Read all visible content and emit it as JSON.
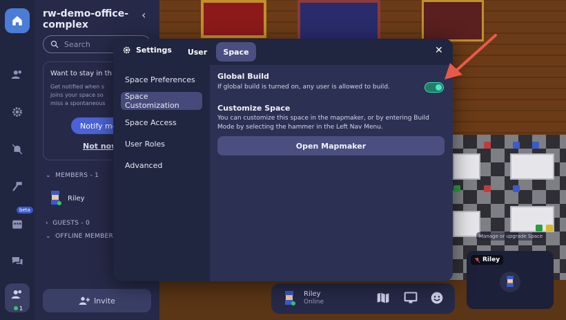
{
  "sidebar": {
    "space_name": "rw-demo-office-complex",
    "search_placeholder": "Search",
    "notify": {
      "title": "Want to stay in th",
      "desc1": "Get notified when s",
      "desc2": "joins your space so",
      "desc3": "miss a spontaneous",
      "button": "Notify me",
      "not_now": "Not now"
    },
    "members_header": "MEMBERS - 1",
    "member_name": "Riley",
    "guests_header": "GUESTS - 0",
    "offline_header": "OFFLINE MEMBER",
    "invite_label": "Invite",
    "rail": {
      "beta": "beta",
      "members_count": "1"
    }
  },
  "settings": {
    "title": "Settings",
    "tabs": [
      "User",
      "Space"
    ],
    "active_tab": "Space",
    "nav": [
      "Space Preferences",
      "Space Customization",
      "Space Access",
      "User Roles",
      "Advanced"
    ],
    "active_nav": "Space Customization",
    "global_build": {
      "title": "Global Build",
      "desc": "If global build is turned on, any user is allowed to build.",
      "enabled": true
    },
    "customize": {
      "title": "Customize Space",
      "desc_line1": "You can customize this space in the mapmaker, or by entering Build",
      "desc_line2": "Mode by selecting the hammer in the Left Nav Menu.",
      "button": "Open Mapmaker"
    }
  },
  "bottombar": {
    "name": "Riley",
    "status": "Online"
  },
  "video": {
    "name": "Riley"
  },
  "game": {
    "manage_hint": "Manage or upgrade Space"
  },
  "colors": {
    "accent": "#4b7dd6",
    "toggle": "#3fdcb2",
    "arrow": "#e8594a",
    "modal_bg": "#202540"
  }
}
